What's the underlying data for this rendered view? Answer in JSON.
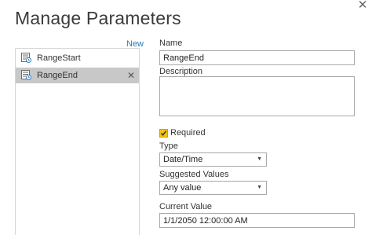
{
  "dialog": {
    "title": "Manage Parameters",
    "close_glyph": "✕"
  },
  "list": {
    "new_label": "New",
    "items": [
      {
        "label": "RangeStart",
        "icon": "parameter-icon",
        "selected": false
      },
      {
        "label": "RangeEnd",
        "icon": "parameter-icon",
        "selected": true,
        "delete_glyph": "✕"
      }
    ]
  },
  "form": {
    "name_label": "Name",
    "name_value": "RangeEnd",
    "description_label": "Description",
    "description_value": "",
    "required_label": "Required",
    "required_checked": true,
    "type_label": "Type",
    "type_value": "Date/Time",
    "suggested_label": "Suggested Values",
    "suggested_value": "Any value",
    "current_label": "Current Value",
    "current_value": "1/1/2050 12:00:00 AM"
  },
  "colors": {
    "accent_link": "#2a7ab0",
    "selected_row": "#c8c8c8",
    "checkbox": "#f2c311"
  }
}
